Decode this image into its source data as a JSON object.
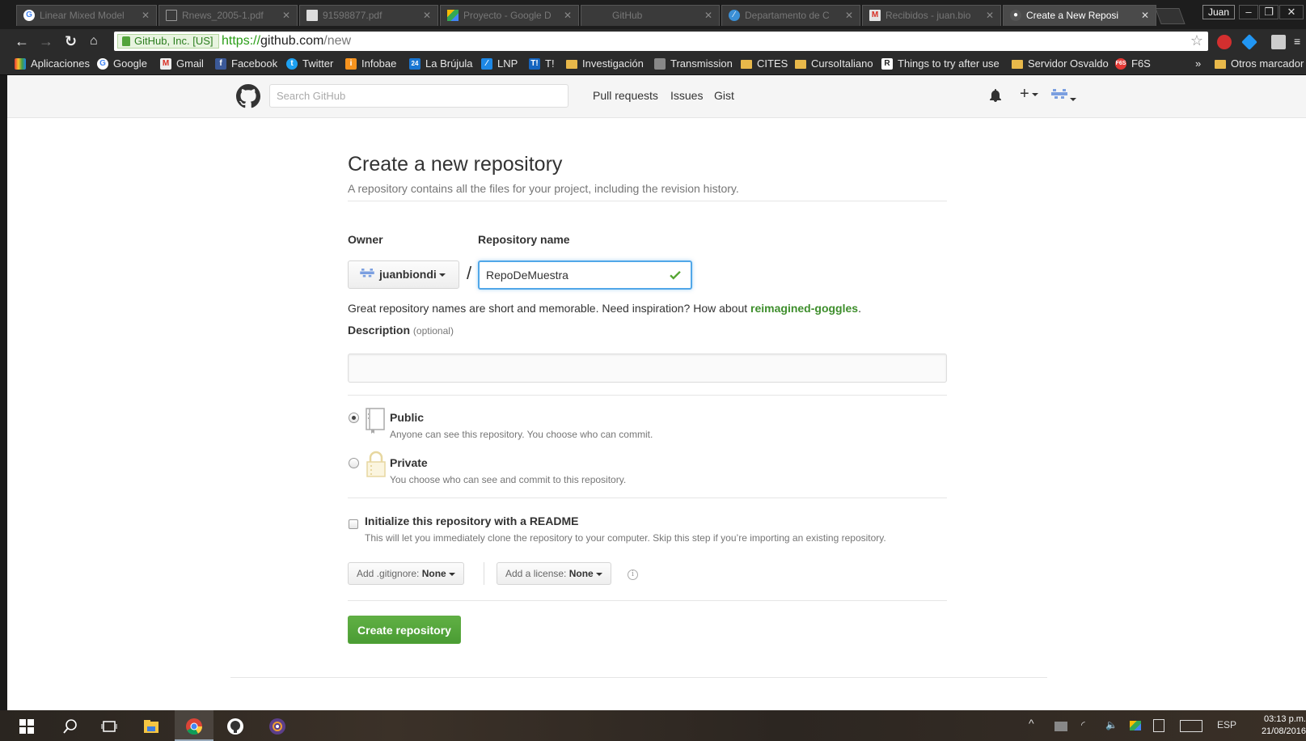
{
  "browser": {
    "tabs": [
      {
        "title": "Linear Mixed Model",
        "icon": "google-icon"
      },
      {
        "title": "Rnews_2005-1.pdf",
        "icon": "document-icon"
      },
      {
        "title": "91598877.pdf",
        "icon": "pdf-image-icon"
      },
      {
        "title": "Proyecto - Google D",
        "icon": "google-drive-icon"
      },
      {
        "title": "GitHub",
        "icon": "blank-icon"
      },
      {
        "title": "Departamento de C",
        "icon": "compass-icon"
      },
      {
        "title": "Recibidos - juan.bio",
        "icon": "gmail-icon"
      },
      {
        "title": "Create a New Reposi",
        "icon": "github-icon",
        "active": true
      }
    ],
    "user": "Juan",
    "secure_label": "GitHub, Inc. [US]",
    "url_scheme": "https://",
    "url_host": "github.com",
    "url_path": "/new",
    "bookmarks": [
      {
        "label": "Aplicaciones",
        "icon": "apps-grid-icon"
      },
      {
        "label": "Google",
        "icon": "google-icon"
      },
      {
        "label": "Gmail",
        "icon": "gmail-icon"
      },
      {
        "label": "Facebook",
        "icon": "facebook-icon"
      },
      {
        "label": "Twitter",
        "icon": "twitter-icon"
      },
      {
        "label": "Infobae",
        "icon": "infobae-icon"
      },
      {
        "label": "La Brújula",
        "icon": "calendar-24-icon"
      },
      {
        "label": "LNP",
        "icon": "lnp-icon"
      },
      {
        "label": "T!",
        "icon": "t-icon"
      },
      {
        "label": "Investigación",
        "icon": "folder-icon"
      },
      {
        "label": "Transmission",
        "icon": "transmission-icon"
      },
      {
        "label": "CITES",
        "icon": "folder-icon"
      },
      {
        "label": "CursoItaliano",
        "icon": "folder-icon"
      },
      {
        "label": "Things to try after use",
        "icon": "r-icon"
      },
      {
        "label": "Servidor Osvaldo",
        "icon": "folder-icon"
      },
      {
        "label": "F6S",
        "icon": "f6s-icon"
      }
    ],
    "more_bookmarks": "»",
    "other_bookmarks": "Otros marcador"
  },
  "github": {
    "search_placeholder": "Search GitHub",
    "nav": [
      "Pull requests",
      "Issues",
      "Gist"
    ]
  },
  "form": {
    "title": "Create a new repository",
    "subtitle": "A repository contains all the files for your project, including the revision history.",
    "owner_label": "Owner",
    "owner_value": "juanbiondi",
    "slash": "/",
    "repo_label": "Repository name",
    "repo_value": "RepoDeMuestra",
    "hint_prefix": "Great repository names are short and memorable. Need inspiration? How about ",
    "hint_suggestion": "reimagined-goggles",
    "hint_suffix": ".",
    "description_label": "Description",
    "description_optional": "(optional)",
    "description_value": "",
    "public_title": "Public",
    "public_note": "Anyone can see this repository. You choose who can commit.",
    "private_title": "Private",
    "private_note": "You choose who can see and commit to this repository.",
    "readme_title": "Initialize this repository with a README",
    "readme_note": "This will let you immediately clone the repository to your computer. Skip this step if you’re importing an existing repository.",
    "gitignore_label": "Add .gitignore:",
    "gitignore_value": "None",
    "license_label": "Add a license:",
    "license_value": "None",
    "submit_label": "Create repository"
  },
  "taskbar": {
    "language": "ESP",
    "time": "03:13 p.m.",
    "date": "21/08/2016"
  },
  "colors": {
    "github_green": "#60b044",
    "focus_blue": "#51a7e8",
    "suggestion_green": "#3e8e2c"
  }
}
